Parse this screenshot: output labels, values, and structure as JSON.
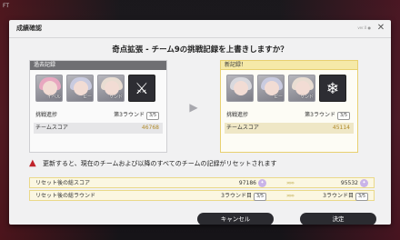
{
  "background": {
    "logo_text": "FT"
  },
  "dialog": {
    "title": "成績確認",
    "version": "ver.0 ●",
    "close_icon": "close-icon"
  },
  "subtitle": "奇点拡張 - チーム9の挑戦記録を上書きしますか？",
  "old_record": {
    "heading": "過去記録",
    "cards": [
      {
        "tag": "イベル",
        "hair": "#e8a7c0"
      },
      {
        "tag": "ピー",
        "hair": "#c9cbe0"
      },
      {
        "tag": "リンド",
        "hair": "#e9ddd2"
      },
      {
        "tag": "",
        "symbol": "⚔",
        "dark": true
      }
    ],
    "progress_label": "挑戦進捗",
    "progress_value": "第3ラウンド",
    "progress_badge": "3/5",
    "score_label": "チームスコア",
    "score_value": "46768"
  },
  "new_record": {
    "heading": "新記録！",
    "cards": [
      {
        "tag": "",
        "hair": "#d9d9de"
      },
      {
        "tag": "ピー",
        "hair": "#c9cbe0"
      },
      {
        "tag": "リンド",
        "hair": "#e9ddd2"
      },
      {
        "tag": "",
        "symbol": "❄",
        "dark": true
      }
    ],
    "progress_label": "挑戦進捗",
    "progress_value": "第3ラウンド",
    "progress_badge": "3/5",
    "score_label": "チームスコア",
    "score_value": "45114"
  },
  "warning": "更新すると、現在のチームおよび以降のすべてのチームの記録がリセットされます",
  "reset_rows": [
    {
      "label": "リセット後の総スコア",
      "before": "97186",
      "arrows": "»»»",
      "after": "95532"
    },
    {
      "label": "リセット後の総ラウンド",
      "before": "3ラウンド目",
      "before_badge": "3/5",
      "arrows": "»»»",
      "after": "3ラウンド目",
      "after_badge": "3/5"
    }
  ],
  "buttons": {
    "cancel": "キャンセル",
    "ok": "決定"
  }
}
